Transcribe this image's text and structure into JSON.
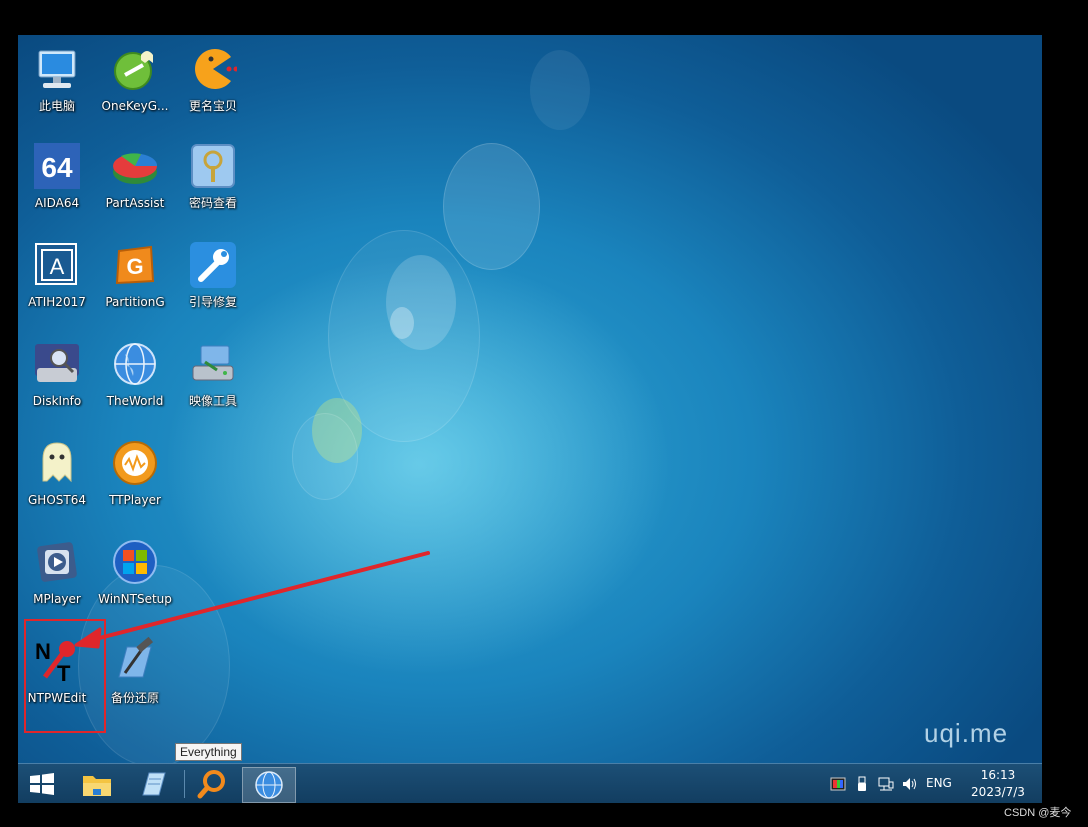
{
  "desktop": {
    "icons": [
      {
        "label": "此电脑",
        "icon": "computer-icon"
      },
      {
        "label": "OneKeyG...",
        "icon": "onekeyghost-icon"
      },
      {
        "label": "更名宝贝",
        "icon": "pacman-icon"
      },
      {
        "label": "AIDA64",
        "icon": "aida64-icon"
      },
      {
        "label": "PartAssist",
        "icon": "partassist-icon"
      },
      {
        "label": "密码查看",
        "icon": "password-viewer-icon"
      },
      {
        "label": "ATIH2017",
        "icon": "acronis-icon"
      },
      {
        "label": "PartitionG",
        "icon": "partitionguru-icon"
      },
      {
        "label": "引导修复",
        "icon": "wrench-icon"
      },
      {
        "label": "DiskInfo",
        "icon": "diskinfo-icon"
      },
      {
        "label": "TheWorld",
        "icon": "globe-icon"
      },
      {
        "label": "映像工具",
        "icon": "imaging-tool-icon"
      },
      {
        "label": "GHOST64",
        "icon": "ghost-icon"
      },
      {
        "label": "TTPlayer",
        "icon": "ttplayer-icon"
      },
      {
        "label": "MPlayer",
        "icon": "mplayer-icon"
      },
      {
        "label": "WinNTSetup",
        "icon": "winntsetup-icon"
      },
      {
        "label": "NTPWEdit",
        "icon": "ntpwedit-icon"
      },
      {
        "label": "备份还原",
        "icon": "backup-restore-icon"
      }
    ],
    "watermark": "uqi.me",
    "highlighted_icon": "NTPWEdit"
  },
  "tooltip": {
    "text": "Everything"
  },
  "taskbar": {
    "buttons": [
      "start-icon",
      "file-explorer-icon",
      "notepad-icon",
      "everything-search-icon",
      "theworld-browser-icon"
    ],
    "tray": {
      "language": "ENG",
      "time": "16:13",
      "date": "2023/7/3"
    }
  },
  "credit": "CSDN @麦今",
  "colors": {
    "annotation": "#e0262b",
    "taskbar": "#16466b"
  }
}
